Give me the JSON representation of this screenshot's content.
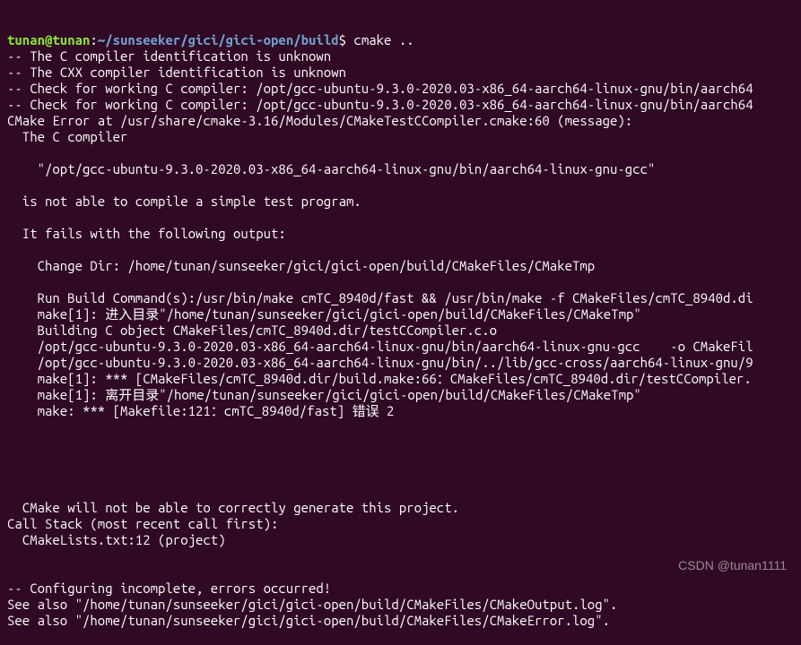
{
  "prompt": {
    "user": "tunan@tunan",
    "separator1": ":",
    "path": "~/sunseeker/gici/gici-open/build",
    "separator2": "$",
    "command": " cmake .."
  },
  "lines": [
    "-- The C compiler identification is unknown",
    "-- The CXX compiler identification is unknown",
    "-- Check for working C compiler: /opt/gcc-ubuntu-9.3.0-2020.03-x86_64-aarch64-linux-gnu/bin/aarch64",
    "-- Check for working C compiler: /opt/gcc-ubuntu-9.3.0-2020.03-x86_64-aarch64-linux-gnu/bin/aarch64",
    "CMake Error at /usr/share/cmake-3.16/Modules/CMakeTestCCompiler.cmake:60 (message):",
    "  The C compiler",
    "",
    "    \"/opt/gcc-ubuntu-9.3.0-2020.03-x86_64-aarch64-linux-gnu/bin/aarch64-linux-gnu-gcc\"",
    "",
    "  is not able to compile a simple test program.",
    "",
    "  It fails with the following output:",
    "",
    "    Change Dir: /home/tunan/sunseeker/gici/gici-open/build/CMakeFiles/CMakeTmp",
    "",
    "    Run Build Command(s):/usr/bin/make cmTC_8940d/fast && /usr/bin/make -f CMakeFiles/cmTC_8940d.di",
    "    make[1]: 进入目录\"/home/tunan/sunseeker/gici/gici-open/build/CMakeFiles/CMakeTmp\"",
    "    Building C object CMakeFiles/cmTC_8940d.dir/testCCompiler.c.o",
    "    /opt/gcc-ubuntu-9.3.0-2020.03-x86_64-aarch64-linux-gnu/bin/aarch64-linux-gnu-gcc    -o CMakeFil",
    "    /opt/gcc-ubuntu-9.3.0-2020.03-x86_64-aarch64-linux-gnu/bin/../lib/gcc-cross/aarch64-linux-gnu/9",
    "    make[1]: *** [CMakeFiles/cmTC_8940d.dir/build.make:66：CMakeFiles/cmTC_8940d.dir/testCCompiler.",
    "    make[1]: 离开目录\"/home/tunan/sunseeker/gici/gici-open/build/CMakeFiles/CMakeTmp\"",
    "    make: *** [Makefile:121：cmTC_8940d/fast] 错误 2",
    "",
    "",
    "",
    "",
    "",
    "  CMake will not be able to correctly generate this project.",
    "Call Stack (most recent call first):",
    "  CMakeLists.txt:12 (project)",
    "",
    "",
    "-- Configuring incomplete, errors occurred!",
    "See also \"/home/tunan/sunseeker/gici/gici-open/build/CMakeFiles/CMakeOutput.log\".",
    "See also \"/home/tunan/sunseeker/gici/gici-open/build/CMakeFiles/CMakeError.log\"."
  ],
  "watermark": "CSDN @tunan1111"
}
